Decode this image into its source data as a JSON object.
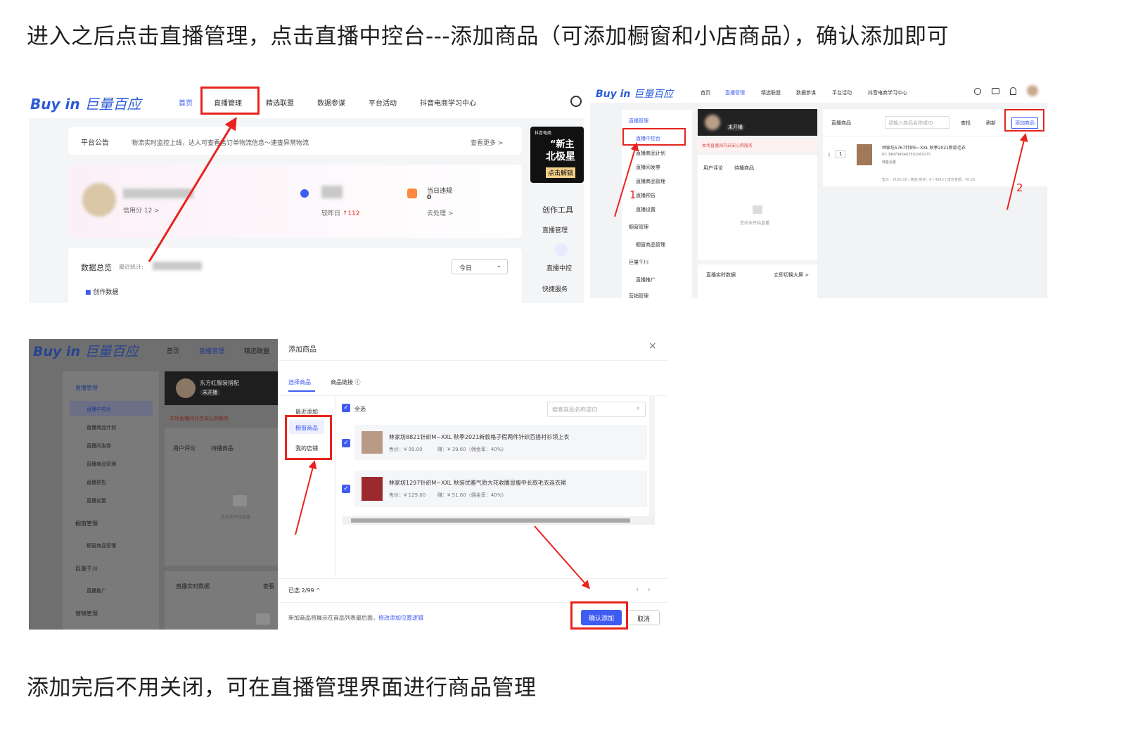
{
  "heading_top": "进入之后点击直播管理，点击直播中控台---添加商品（可添加橱窗和小店商品），确认添加即可",
  "heading_bottom": "添加完后不用关闭，可在直播管理界面进行商品管理",
  "colors": {
    "accent": "#3f5cf2",
    "annotation_red": "#e8231e",
    "logo_blue": "#2b5bd7"
  },
  "shot1": {
    "logo_en": "Buy in",
    "logo_cn": "巨量百应",
    "nav": [
      "首页",
      "直播管理",
      "精选联盟",
      "数据参谋",
      "平台活动",
      "抖音电商学习中心"
    ],
    "announcement_label": "平台公告",
    "announcement_text": "物流实时监控上线，达人可查看售订单物流信息～速查异常物流",
    "see_more": "查看更多 >",
    "credit": "信用分 12 >",
    "compare_label": "较昨日",
    "compare_value": "112",
    "today_violation": "当日违规",
    "violation_count": "0",
    "to_handle": "去处理 >",
    "data_overview": "数据总览",
    "recent_stats": "最近统计:",
    "date_select": "今日",
    "creation_data": "创作数据",
    "banner_line1": "抖音电商",
    "banner_line2": "“新主",
    "banner_line3": "北极星",
    "banner_btn": "点击解锁",
    "creation_tools": "创作工具",
    "live_manage": "直播管理",
    "live_console": "直播中控",
    "quick_service": "快捷服务"
  },
  "shot2": {
    "logo_en": "Buy in",
    "logo_cn": "巨量百应",
    "nav": [
      "首页",
      "直播管理",
      "精选联盟",
      "数据参谋",
      "平台活动",
      "抖音电商学习中心"
    ],
    "sidebar": [
      "直播管理",
      "直播中控台",
      "直播商品计划",
      "直播间发券",
      "直播商品管理",
      "直播预告",
      "直播设置",
      "橱窗管理",
      "橱窗商品管理",
      "巨量千川",
      "直播推广",
      "营销管理"
    ],
    "not_live": "未开播",
    "safe_service": "本场直播间开启安心购服务",
    "tabs": [
      "用户评论",
      "待播商品"
    ],
    "not_live_empty": "您尚未开始直播",
    "realtime_data": "直播实时数据",
    "big_screen": "立即切换大屏 >",
    "goods_label": "直播商品",
    "search_placeholder": "请输入商品名称或ID",
    "search_btn": "查找",
    "refresh_btn": "刷新",
    "add_goods_btn": "添加商品",
    "item_index": "1",
    "item_title": "林家坊5767针织S~XXL 秋季2021新款毛衣",
    "item_id": "ID: 3497343402591560175",
    "item_tag": "佣金设置",
    "item_stats": "售价：¥100.00  |  佣金/库存：0 / 4842  |  成交金额：¥0.00",
    "anno1": "1",
    "anno2": "2"
  },
  "shot3": {
    "logo_en": "Buy in",
    "logo_cn": "巨量百应",
    "nav": [
      "首页",
      "直播管理",
      "精选联盟"
    ],
    "sidebar": [
      "直播管理",
      "直播中控台",
      "直播商品计划",
      "直播间发券",
      "直播商品管理",
      "直播预告",
      "直播设置",
      "橱窗管理",
      "橱窗商品管理",
      "巨量千川",
      "直播推广",
      "营销管理"
    ],
    "shop_name": "东方红服装搭配",
    "not_live": "未开播",
    "safe_service": "本场直播间开启安心购服务",
    "tabs": [
      "用户评论",
      "待播商品"
    ],
    "not_live_empty": "您尚未开始直播",
    "realtime_data": "直播实时数据",
    "check": "查看",
    "modal_title": "添加商品",
    "modal_tabs": [
      "选择商品",
      "商品链接"
    ],
    "sources": [
      "最近添加",
      "橱窗商品",
      "我的店铺"
    ],
    "select_all": "全选",
    "search_placeholder": "搜索商品名称或ID",
    "products": [
      {
        "title": "林家坊8821针织M~XXL 秋季2021新款格子假两件针织百搭衬衫领上衣",
        "price": "售价：¥ 99.00",
        "commission": "赚：¥ 39.60（佣金率：40%）"
      },
      {
        "title": "林家坊1297针织M~XXL 秋装优雅气质大花收腰显瘦中长款毛衣连衣裙",
        "price": "售价：¥ 129.00",
        "commission": "赚：¥ 51.60（佣金率：40%）"
      }
    ],
    "selected": "已选 2/99 ^",
    "footer_note": "新加商品将展示在商品列表最后面，",
    "footer_link": "修改添加位置逻辑",
    "confirm_btn": "确认添加",
    "cancel_btn": "取消"
  }
}
